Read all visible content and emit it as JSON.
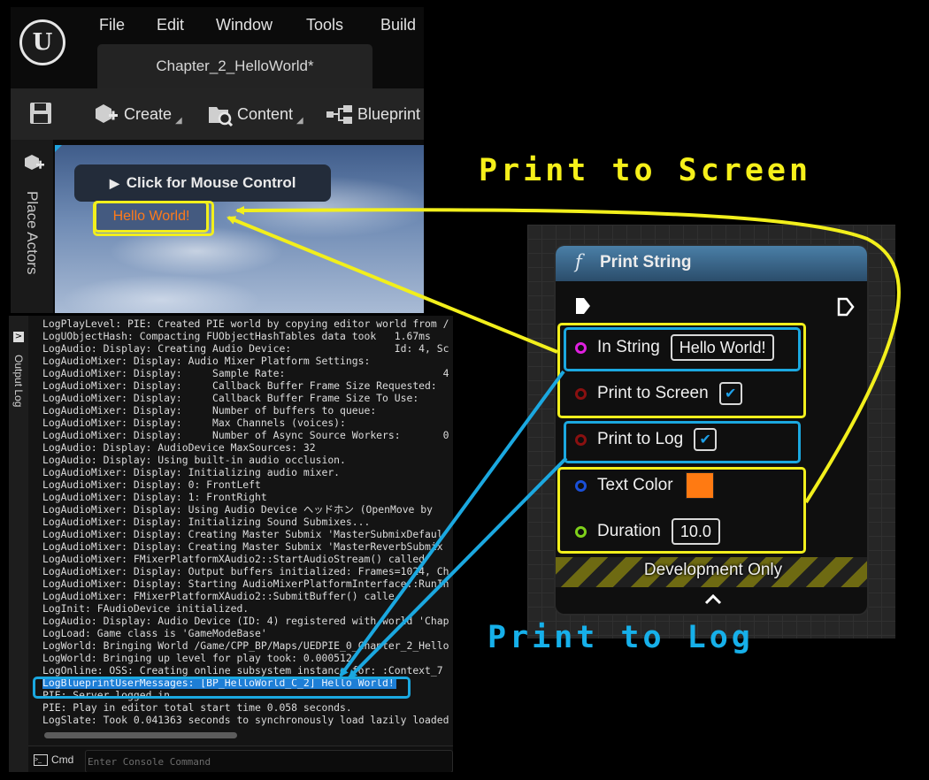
{
  "editor": {
    "logo_text": "U",
    "menu": [
      "File",
      "Edit",
      "Window",
      "Tools",
      "Build"
    ],
    "tab_title": "Chapter_2_HelloWorld*",
    "toolbar": {
      "create_label": "Create",
      "content_label": "Content",
      "blueprint_label": "Blueprint"
    },
    "place_actors_label": "Place Actors",
    "viewport": {
      "mouse_control_label": "Click for Mouse Control",
      "hello_text": "Hello World!"
    }
  },
  "output_log": {
    "tab_label": "Output Log",
    "lines": [
      "LogPlayLevel: PIE: Created PIE world by copying editor world from /",
      "LogUObjectHash: Compacting FUObjectHashTables data took   1.67ms",
      "LogAudio: Display: Creating Audio Device:                 Id: 4, Sc",
      "LogAudioMixer: Display: Audio Mixer Platform Settings:",
      "LogAudioMixer: Display:     Sample Rate:                          4",
      "LogAudioMixer: Display:     Callback Buffer Frame Size Requested: ",
      "LogAudioMixer: Display:     Callback Buffer Frame Size To Use:    ",
      "LogAudioMixer: Display:     Number of buffers to queue:           ",
      "LogAudioMixer: Display:     Max Channels (voices):                ",
      "LogAudioMixer: Display:     Number of Async Source Workers:       0",
      "LogAudio: Display: AudioDevice MaxSources: 32",
      "LogAudio: Display: Using built-in audio occlusion.",
      "LogAudioMixer: Display: Initializing audio mixer.",
      "LogAudioMixer: Display: 0: FrontLeft",
      "LogAudioMixer: Display: 1: FrontRight",
      "LogAudioMixer: Display: Using Audio Device ヘッドホン (OpenMove by",
      "LogAudioMixer: Display: Initializing Sound Submixes...",
      "LogAudioMixer: Display: Creating Master Submix 'MasterSubmixDefaul",
      "LogAudioMixer: Display: Creating Master Submix 'MasterReverbSubmix",
      "LogAudioMixer: FMixerPlatformXAudio2::StartAudioStream() called",
      "LogAudioMixer: Display: Output buffers initialized: Frames=1024, Ch",
      "LogAudioMixer: Display: Starting AudioMixerPlatformInterface::RunIn",
      "LogAudioMixer: FMixerPlatformXAudio2::SubmitBuffer() calle",
      "LogInit: FAudioDevice initialized.",
      "LogAudio: Display: Audio Device (ID: 4) registered with world 'Chap",
      "LogLoad: Game class is 'GameModeBase'",
      "LogWorld: Bringing World /Game/CPP_BP/Maps/UEDPIE_0_Chapter_2_Hello",
      "LogWorld: Bringing up level for play took: 0.000512",
      "LogOnline: OSS: Creating online subsystem instance for: :Context_7",
      "LogBlueprintUserMessages: [BP_HelloWorld_C_2] Hello World!",
      "PIE: Server logged in",
      "PIE: Play in editor total start time 0.058 seconds.",
      "LogSlate: Took 0.041363 seconds to synchronously load lazily loaded"
    ],
    "cmd_label": "Cmd",
    "console_placeholder": "Enter Console Command"
  },
  "node": {
    "title": "Print String",
    "pins": {
      "in_string": {
        "label": "In String",
        "value": "Hello World!"
      },
      "print_to_screen": {
        "label": "Print to Screen",
        "checked": true
      },
      "print_to_log": {
        "label": "Print to Log",
        "checked": true
      },
      "text_color": {
        "label": "Text Color",
        "color": "#ff7a12"
      },
      "duration": {
        "label": "Duration",
        "value": "10.0"
      }
    },
    "development_only_label": "Development Only",
    "pin_colors": {
      "string": "#e020e0",
      "bool": "#8a1010",
      "struct": "#1a50d8",
      "float": "#7fd11a"
    }
  },
  "annotations": {
    "print_to_screen_caption": "Print to Screen",
    "print_to_log_caption": "Print to Log",
    "colors": {
      "screen": "#f2ef1c",
      "log": "#1ba8e0"
    }
  }
}
